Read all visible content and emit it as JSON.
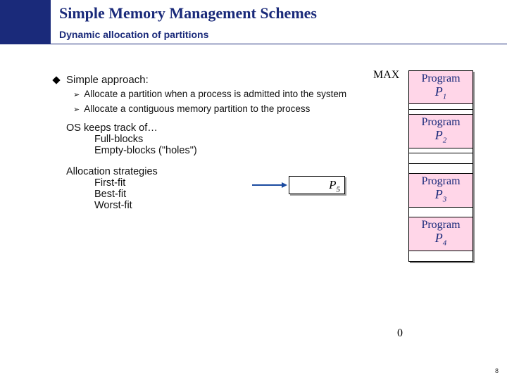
{
  "header": {
    "title": "Simple Memory Management Schemes",
    "subtitle": "Dynamic allocation of partitions"
  },
  "simple": {
    "label": "Simple approach:",
    "bul1": "Allocate a partition when a process is admitted into the system",
    "bul2": "Allocate a contiguous memory partition to the process"
  },
  "track": {
    "head": "OS keeps track of…",
    "l1": "Full-blocks",
    "l2": "Empty-blocks (\"holes\")"
  },
  "strat": {
    "head": "Allocation strategies",
    "l1": "First-fit",
    "l2": "Best-fit",
    "l3": "Worst-fit"
  },
  "mem": {
    "max": "MAX",
    "zero": "0",
    "program": "Program",
    "p1": "1",
    "p2": "2",
    "p3": "3",
    "p4": "4",
    "p5": "5"
  },
  "page": "8"
}
